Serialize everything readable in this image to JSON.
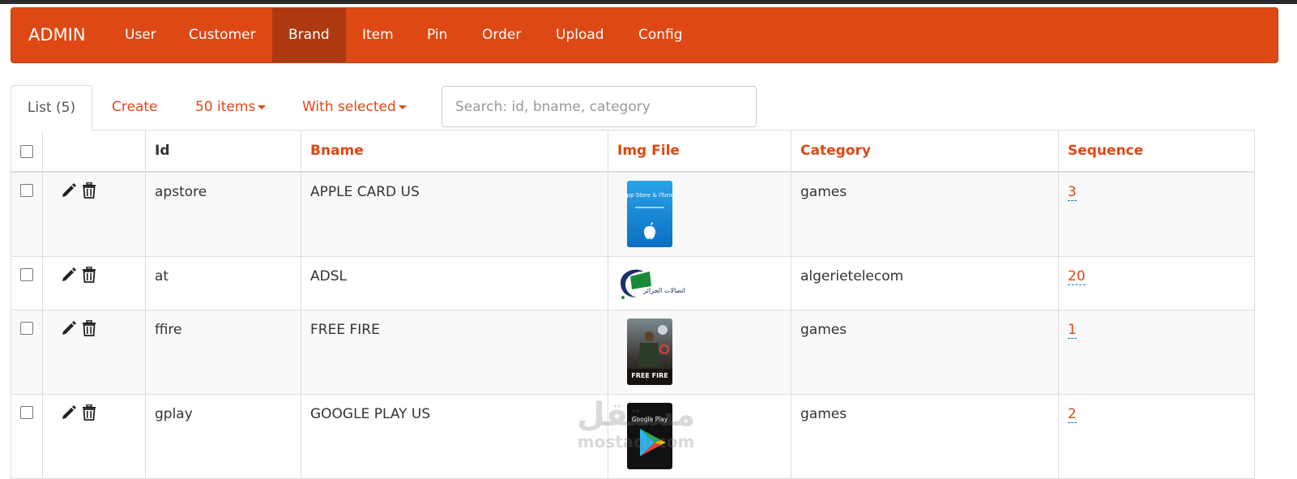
{
  "navbar": {
    "brand": "ADMIN",
    "items": [
      {
        "label": "User"
      },
      {
        "label": "Customer"
      },
      {
        "label": "Brand",
        "active": true
      },
      {
        "label": "Item"
      },
      {
        "label": "Pin"
      },
      {
        "label": "Order"
      },
      {
        "label": "Upload"
      },
      {
        "label": "Config"
      }
    ],
    "accent_color": "#dd4814",
    "active_color": "#ae3910"
  },
  "tabs": {
    "list": "List (5)",
    "create": "Create",
    "items_per_page": "50 items",
    "with_selected": "With selected"
  },
  "search": {
    "placeholder": "Search: id, bname, category",
    "value": ""
  },
  "table": {
    "columns": [
      "Id",
      "Bname",
      "Img File",
      "Category",
      "Sequence"
    ],
    "rows": [
      {
        "id": "apstore",
        "bname": "APPLE CARD US",
        "img": "app-store-itunes-card-thumbnail",
        "img_text": "App Store & iTunes",
        "category": "games",
        "sequence": "3"
      },
      {
        "id": "at",
        "bname": "ADSL",
        "img": "algerie-telecom-logo",
        "img_text": "اتصالات الجزائر",
        "category": "algerietelecom",
        "sequence": "20"
      },
      {
        "id": "ffire",
        "bname": "FREE FIRE",
        "img": "free-fire-card-thumbnail",
        "img_text": "FREE FIRE",
        "category": "games",
        "sequence": "1"
      },
      {
        "id": "gplay",
        "bname": "GOOGLE PLAY US",
        "img": "google-play-card-thumbnail",
        "img_text": "Google Play",
        "category": "games",
        "sequence": "2"
      }
    ]
  },
  "icons": {
    "edit": "pencil-icon",
    "delete": "trash-icon"
  },
  "watermark": {
    "arabic": "مستقل",
    "latin": "mostaql.com"
  }
}
